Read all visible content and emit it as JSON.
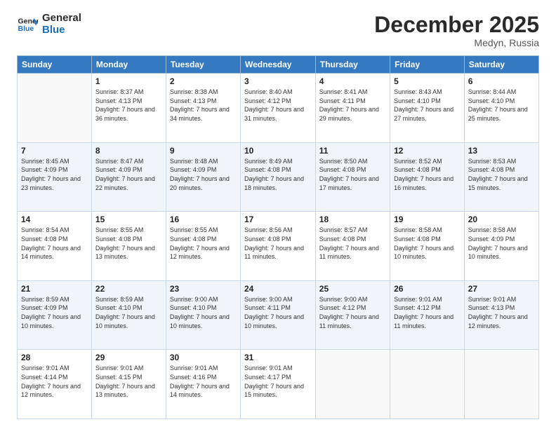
{
  "header": {
    "logo_line1": "General",
    "logo_line2": "Blue",
    "month_title": "December 2025",
    "location": "Medyn, Russia"
  },
  "days_of_week": [
    "Sunday",
    "Monday",
    "Tuesday",
    "Wednesday",
    "Thursday",
    "Friday",
    "Saturday"
  ],
  "weeks": [
    [
      {
        "day": "",
        "sunrise": "",
        "sunset": "",
        "daylight": ""
      },
      {
        "day": "1",
        "sunrise": "Sunrise: 8:37 AM",
        "sunset": "Sunset: 4:13 PM",
        "daylight": "Daylight: 7 hours and 36 minutes."
      },
      {
        "day": "2",
        "sunrise": "Sunrise: 8:38 AM",
        "sunset": "Sunset: 4:13 PM",
        "daylight": "Daylight: 7 hours and 34 minutes."
      },
      {
        "day": "3",
        "sunrise": "Sunrise: 8:40 AM",
        "sunset": "Sunset: 4:12 PM",
        "daylight": "Daylight: 7 hours and 31 minutes."
      },
      {
        "day": "4",
        "sunrise": "Sunrise: 8:41 AM",
        "sunset": "Sunset: 4:11 PM",
        "daylight": "Daylight: 7 hours and 29 minutes."
      },
      {
        "day": "5",
        "sunrise": "Sunrise: 8:43 AM",
        "sunset": "Sunset: 4:10 PM",
        "daylight": "Daylight: 7 hours and 27 minutes."
      },
      {
        "day": "6",
        "sunrise": "Sunrise: 8:44 AM",
        "sunset": "Sunset: 4:10 PM",
        "daylight": "Daylight: 7 hours and 25 minutes."
      }
    ],
    [
      {
        "day": "7",
        "sunrise": "Sunrise: 8:45 AM",
        "sunset": "Sunset: 4:09 PM",
        "daylight": "Daylight: 7 hours and 23 minutes."
      },
      {
        "day": "8",
        "sunrise": "Sunrise: 8:47 AM",
        "sunset": "Sunset: 4:09 PM",
        "daylight": "Daylight: 7 hours and 22 minutes."
      },
      {
        "day": "9",
        "sunrise": "Sunrise: 8:48 AM",
        "sunset": "Sunset: 4:09 PM",
        "daylight": "Daylight: 7 hours and 20 minutes."
      },
      {
        "day": "10",
        "sunrise": "Sunrise: 8:49 AM",
        "sunset": "Sunset: 4:08 PM",
        "daylight": "Daylight: 7 hours and 18 minutes."
      },
      {
        "day": "11",
        "sunrise": "Sunrise: 8:50 AM",
        "sunset": "Sunset: 4:08 PM",
        "daylight": "Daylight: 7 hours and 17 minutes."
      },
      {
        "day": "12",
        "sunrise": "Sunrise: 8:52 AM",
        "sunset": "Sunset: 4:08 PM",
        "daylight": "Daylight: 7 hours and 16 minutes."
      },
      {
        "day": "13",
        "sunrise": "Sunrise: 8:53 AM",
        "sunset": "Sunset: 4:08 PM",
        "daylight": "Daylight: 7 hours and 15 minutes."
      }
    ],
    [
      {
        "day": "14",
        "sunrise": "Sunrise: 8:54 AM",
        "sunset": "Sunset: 4:08 PM",
        "daylight": "Daylight: 7 hours and 14 minutes."
      },
      {
        "day": "15",
        "sunrise": "Sunrise: 8:55 AM",
        "sunset": "Sunset: 4:08 PM",
        "daylight": "Daylight: 7 hours and 13 minutes."
      },
      {
        "day": "16",
        "sunrise": "Sunrise: 8:55 AM",
        "sunset": "Sunset: 4:08 PM",
        "daylight": "Daylight: 7 hours and 12 minutes."
      },
      {
        "day": "17",
        "sunrise": "Sunrise: 8:56 AM",
        "sunset": "Sunset: 4:08 PM",
        "daylight": "Daylight: 7 hours and 11 minutes."
      },
      {
        "day": "18",
        "sunrise": "Sunrise: 8:57 AM",
        "sunset": "Sunset: 4:08 PM",
        "daylight": "Daylight: 7 hours and 11 minutes."
      },
      {
        "day": "19",
        "sunrise": "Sunrise: 8:58 AM",
        "sunset": "Sunset: 4:08 PM",
        "daylight": "Daylight: 7 hours and 10 minutes."
      },
      {
        "day": "20",
        "sunrise": "Sunrise: 8:58 AM",
        "sunset": "Sunset: 4:09 PM",
        "daylight": "Daylight: 7 hours and 10 minutes."
      }
    ],
    [
      {
        "day": "21",
        "sunrise": "Sunrise: 8:59 AM",
        "sunset": "Sunset: 4:09 PM",
        "daylight": "Daylight: 7 hours and 10 minutes."
      },
      {
        "day": "22",
        "sunrise": "Sunrise: 8:59 AM",
        "sunset": "Sunset: 4:10 PM",
        "daylight": "Daylight: 7 hours and 10 minutes."
      },
      {
        "day": "23",
        "sunrise": "Sunrise: 9:00 AM",
        "sunset": "Sunset: 4:10 PM",
        "daylight": "Daylight: 7 hours and 10 minutes."
      },
      {
        "day": "24",
        "sunrise": "Sunrise: 9:00 AM",
        "sunset": "Sunset: 4:11 PM",
        "daylight": "Daylight: 7 hours and 10 minutes."
      },
      {
        "day": "25",
        "sunrise": "Sunrise: 9:00 AM",
        "sunset": "Sunset: 4:12 PM",
        "daylight": "Daylight: 7 hours and 11 minutes."
      },
      {
        "day": "26",
        "sunrise": "Sunrise: 9:01 AM",
        "sunset": "Sunset: 4:12 PM",
        "daylight": "Daylight: 7 hours and 11 minutes."
      },
      {
        "day": "27",
        "sunrise": "Sunrise: 9:01 AM",
        "sunset": "Sunset: 4:13 PM",
        "daylight": "Daylight: 7 hours and 12 minutes."
      }
    ],
    [
      {
        "day": "28",
        "sunrise": "Sunrise: 9:01 AM",
        "sunset": "Sunset: 4:14 PM",
        "daylight": "Daylight: 7 hours and 12 minutes."
      },
      {
        "day": "29",
        "sunrise": "Sunrise: 9:01 AM",
        "sunset": "Sunset: 4:15 PM",
        "daylight": "Daylight: 7 hours and 13 minutes."
      },
      {
        "day": "30",
        "sunrise": "Sunrise: 9:01 AM",
        "sunset": "Sunset: 4:16 PM",
        "daylight": "Daylight: 7 hours and 14 minutes."
      },
      {
        "day": "31",
        "sunrise": "Sunrise: 9:01 AM",
        "sunset": "Sunset: 4:17 PM",
        "daylight": "Daylight: 7 hours and 15 minutes."
      },
      {
        "day": "",
        "sunrise": "",
        "sunset": "",
        "daylight": ""
      },
      {
        "day": "",
        "sunrise": "",
        "sunset": "",
        "daylight": ""
      },
      {
        "day": "",
        "sunrise": "",
        "sunset": "",
        "daylight": ""
      }
    ]
  ]
}
